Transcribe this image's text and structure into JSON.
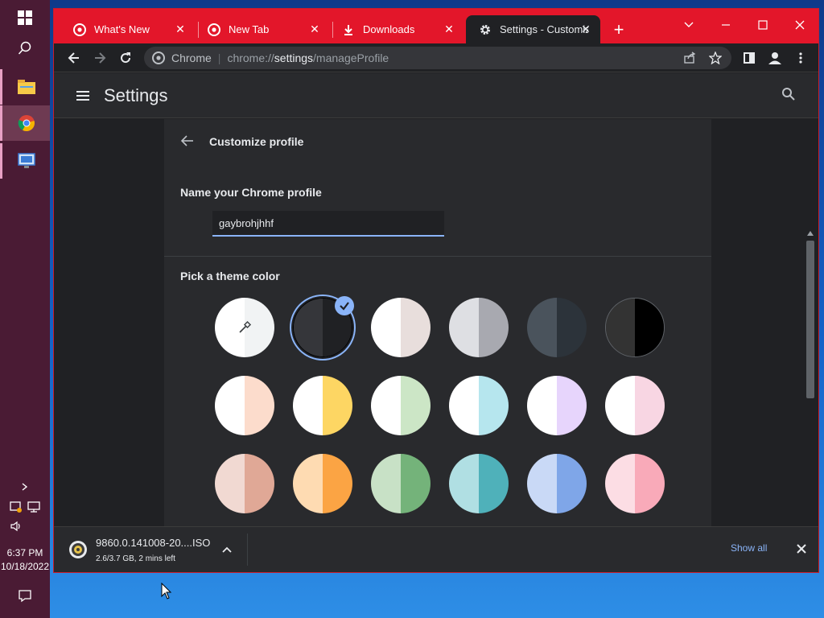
{
  "taskbar": {
    "start_icon": "windows-start-icon",
    "search_icon": "search-icon",
    "apps": [
      {
        "name": "file-explorer-icon"
      },
      {
        "name": "chrome-icon"
      },
      {
        "name": "remote-desktop-icon"
      }
    ],
    "clock_time": "6:37 PM",
    "clock_date": "10/18/2022"
  },
  "browser": {
    "tabs": [
      {
        "label": "What's New",
        "icon": "chrome-logo-icon"
      },
      {
        "label": "New Tab",
        "icon": "chrome-logo-icon"
      },
      {
        "label": "Downloads",
        "icon": "download-icon"
      },
      {
        "label": "Settings - Customize",
        "icon": "gear-icon"
      }
    ],
    "omnibox": {
      "chip": "Chrome",
      "url_prefix": "chrome://",
      "url_host": "settings",
      "url_path": "/manageProfile"
    }
  },
  "settings": {
    "title": "Settings",
    "page_heading": "Customize profile",
    "name_label": "Name your Chrome profile",
    "profile_name": "gaybrohjhhf",
    "theme_label": "Pick a theme color",
    "theme_colors": [
      {
        "left": "#ffffff",
        "right": "#f1f3f4",
        "custom": true
      },
      {
        "left": "#35363a",
        "right": "#202124",
        "selected": true
      },
      {
        "left": "#ffffff",
        "right": "#e8dedc"
      },
      {
        "left": "#dedfe3",
        "right": "#a8a9b0"
      },
      {
        "left": "#4a535c",
        "right": "#2c333a"
      },
      {
        "left": "#333333",
        "right": "#000000"
      },
      {
        "left": "#ffffff",
        "right": "#fcdccc"
      },
      {
        "left": "#ffffff",
        "right": "#fdd663"
      },
      {
        "left": "#ffffff",
        "right": "#cce6c6"
      },
      {
        "left": "#ffffff",
        "right": "#b6e6ee"
      },
      {
        "left": "#ffffff",
        "right": "#e7d5fc"
      },
      {
        "left": "#ffffff",
        "right": "#f8d6e3"
      },
      {
        "left": "#f1d9d2",
        "right": "#e0a896"
      },
      {
        "left": "#fedbb2",
        "right": "#fba444"
      },
      {
        "left": "#c8e1c6",
        "right": "#74b37a"
      },
      {
        "left": "#b0dfe3",
        "right": "#4fb1ba"
      },
      {
        "left": "#c9d9f6",
        "right": "#7fa6e8"
      },
      {
        "left": "#fcdde4",
        "right": "#f9aab9"
      }
    ]
  },
  "download": {
    "filename": "9860.0.141008-20....ISO",
    "status": "2.6/3.7 GB, 2 mins left",
    "show_all": "Show all"
  },
  "colors": {
    "titlebar": "#e3162a",
    "accent": "#8ab4f8",
    "page_bg": "#202124",
    "card_bg": "#292a2d",
    "taskbar": "#4a1b34"
  }
}
